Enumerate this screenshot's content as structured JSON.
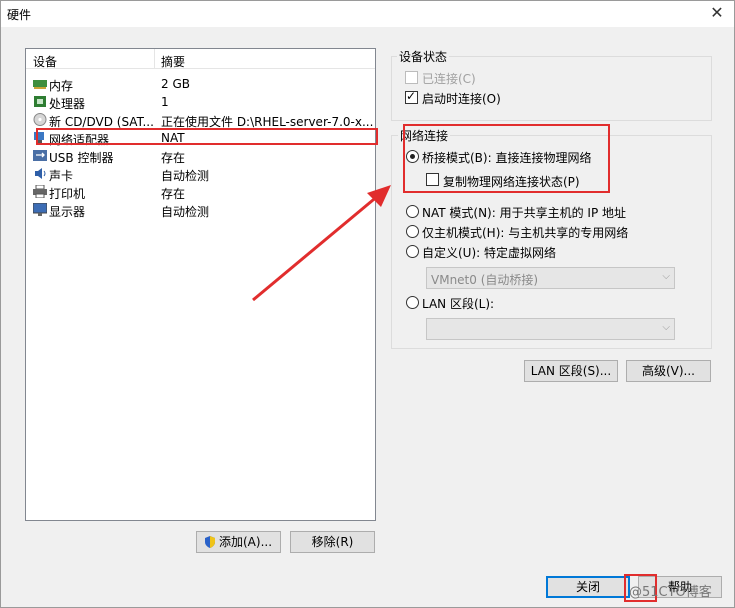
{
  "window": {
    "title": "硬件",
    "close_glyph": "✕"
  },
  "device_list": {
    "columns": {
      "device": "设备",
      "summary": "摘要"
    },
    "rows": [
      {
        "name": "内存",
        "summary": "2 GB",
        "icon": "memory-icon"
      },
      {
        "name": "处理器",
        "summary": "1",
        "icon": "processor-icon"
      },
      {
        "name": "新 CD/DVD (SAT...",
        "summary": "正在使用文件 D:\\RHEL-server-7.0-x...",
        "icon": "cd-dvd-icon"
      },
      {
        "name": "网络适配器",
        "summary": "NAT",
        "icon": "network-adapter-icon"
      },
      {
        "name": "USB 控制器",
        "summary": "存在",
        "icon": "usb-icon"
      },
      {
        "name": "声卡",
        "summary": "自动检测",
        "icon": "sound-card-icon"
      },
      {
        "name": "打印机",
        "summary": "存在",
        "icon": "printer-icon"
      },
      {
        "name": "显示器",
        "summary": "自动检测",
        "icon": "display-icon"
      }
    ]
  },
  "buttons": {
    "add": "添加(A)...",
    "remove": "移除(R)",
    "lan_segments": "LAN 区段(S)...",
    "advanced": "高级(V)...",
    "close": "关闭",
    "help": "帮助"
  },
  "device_status": {
    "title": "设备状态",
    "connected": {
      "label": "已连接(C)",
      "checked": false,
      "enabled": false
    },
    "connect_at_power_on": {
      "label": "启动时连接(O)",
      "checked": true
    }
  },
  "network_connection": {
    "title": "网络连接",
    "bridged": "桥接模式(B): 直接连接物理网络",
    "replicate": "复制物理网络连接状态(P)",
    "nat": "NAT 模式(N): 用于共享主机的 IP 地址",
    "host_only": "仅主机模式(H): 与主机共享的专用网络",
    "custom": "自定义(U): 特定虚拟网络",
    "custom_network": "VMnet0 (自动桥接)",
    "lan_segment": "LAN 区段(L):",
    "lan_segment_value": "",
    "selected": "bridged"
  },
  "watermark": "@51CTO博客",
  "colors": {
    "annotation": "#e12d2d",
    "focus": "#0078d7"
  }
}
